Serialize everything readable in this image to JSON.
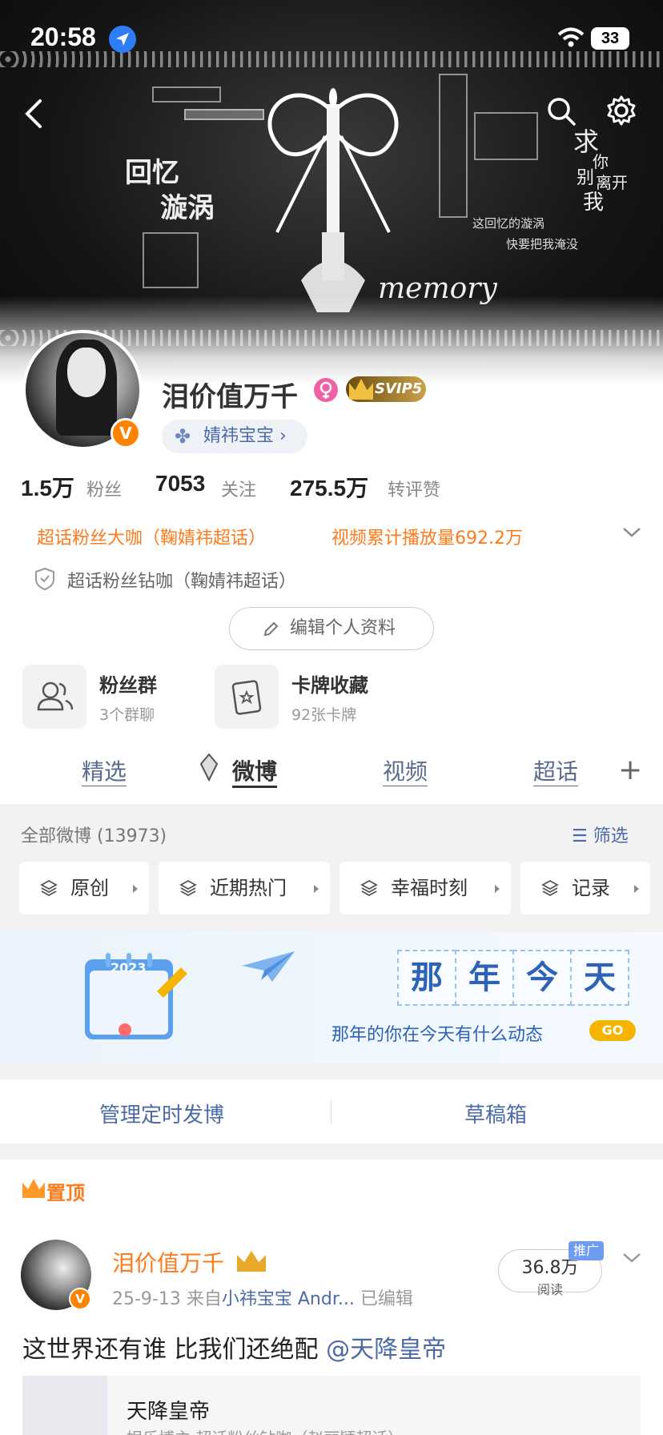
{
  "status_bar": {
    "time": "20:58",
    "battery": "33"
  },
  "banner": {
    "text_huiyi": "回忆",
    "text_xuanwo": "漩涡",
    "text_memory": "memory",
    "text_qiu": "求",
    "text_ni": "你",
    "text_bie": "别",
    "text_likai": "离开",
    "text_wo": "我",
    "text_huiyi_line1": "这回忆的漩涡",
    "text_huiyi_line2": "快要把我淹没"
  },
  "profile": {
    "username": "泪价值万千",
    "svip": "SVIP5",
    "group_chip": "婧祎宝宝",
    "fans_num": "1.5万",
    "fans_label": "粉丝",
    "follow_num": "7053",
    "follow_label": "关注",
    "likes_num": "275.5万",
    "likes_label": "转评赞",
    "honor_1": "超话粉丝大咖（鞠婧祎超话）",
    "honor_2": "视频累计播放量692.2万",
    "fan_level": "超话粉丝钻咖（鞠婧祎超话）",
    "edit_profile": "编辑个人资料"
  },
  "tiles": [
    {
      "title": "粉丝群",
      "sub": "3个群聊"
    },
    {
      "title": "卡牌收藏",
      "sub": "92张卡牌"
    }
  ],
  "tabs": [
    "精选",
    "微博",
    "视频",
    "超话"
  ],
  "filter": {
    "all_count": "全部微博 (13973)",
    "filter_label": "筛选",
    "chips": [
      "原创",
      "近期热门",
      "幸福时刻",
      "记录"
    ]
  },
  "memory": {
    "title_chars": [
      "那",
      "年",
      "今",
      "天"
    ],
    "subtitle": "那年的你在今天有什么动态",
    "go": "GO",
    "calendar_year": "2023"
  },
  "manage": {
    "scheduled": "管理定时发博",
    "drafts": "草稿箱"
  },
  "pinned": {
    "label": "置顶",
    "author": "泪价值万千",
    "date": "25-9-13",
    "from": "来自",
    "source": "小祎宝宝 Andr...",
    "edited": "已编辑",
    "read_num": "36.8万",
    "read_label": "阅读",
    "promo": "推广",
    "body_text": "这世界还有谁 比我们还绝配 ",
    "mention": "@天降皇帝",
    "card_title": "天降皇帝",
    "card_sub": "娱乐博主 超话粉丝钻咖（赵丽颖超话）"
  },
  "colors": {
    "accent_orange": "#ff7a1a",
    "link_blue": "#4d6aa8",
    "vip_orange": "#ff8200"
  }
}
